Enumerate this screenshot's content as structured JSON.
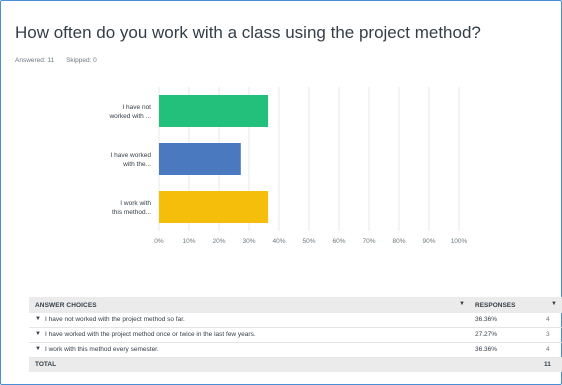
{
  "question": {
    "title": "How often do you work with a class using the project method?",
    "answered": "Answered: 11",
    "skipped": "Skipped: 0"
  },
  "chart_data": {
    "type": "bar",
    "orientation": "horizontal",
    "categories": [
      [
        "I have not",
        "worked with ..."
      ],
      [
        "I have worked",
        "with the..."
      ],
      [
        "I work with",
        "this method..."
      ]
    ],
    "values": [
      36.36,
      27.27,
      36.36
    ],
    "colors": [
      "#22c07a",
      "#4a79bf",
      "#f5be0b"
    ],
    "xticks": [
      "0%",
      "10%",
      "20%",
      "30%",
      "40%",
      "50%",
      "60%",
      "70%",
      "80%",
      "90%",
      "100%"
    ],
    "xlim": [
      0,
      100
    ],
    "grid": true
  },
  "table": {
    "header_choices": "ANSWER CHOICES",
    "header_responses": "RESPONSES",
    "sort_icon": "▼",
    "rows": [
      {
        "label": "I have not worked with the project method so far.",
        "pct": "36.36%",
        "count": "4"
      },
      {
        "label": "I have worked with the project method once or twice in the last few years.",
        "pct": "27.27%",
        "count": "3"
      },
      {
        "label": "I work with this method every semester.",
        "pct": "36.36%",
        "count": "4"
      }
    ],
    "total_label": "TOTAL",
    "total_count": "11"
  }
}
